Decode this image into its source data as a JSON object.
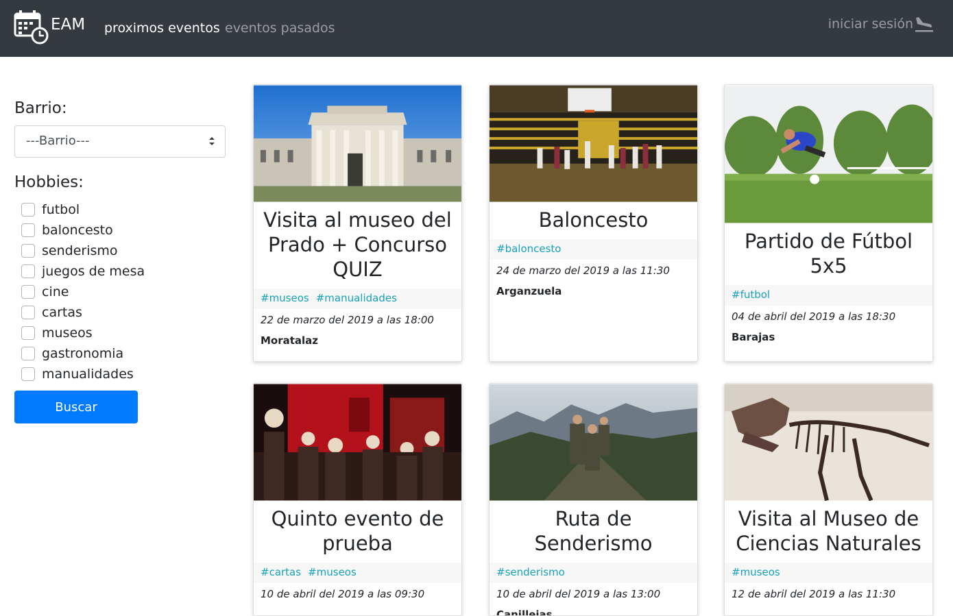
{
  "nav": {
    "brand": "EAM",
    "links": [
      "proximos eventos",
      "eventos pasados"
    ],
    "login": "iniciar sesión"
  },
  "sidebar": {
    "barrio_label": "Barrio:",
    "barrio_select": "---Barrio---",
    "hobbies_label": "Hobbies:",
    "hobbies": [
      "futbol",
      "baloncesto",
      "senderismo",
      "juegos de mesa",
      "cine",
      "cartas",
      "museos",
      "gastronomia",
      "manualidades"
    ],
    "search_button": "Buscar"
  },
  "events": [
    {
      "title": "Visita al museo del Prado + Concurso QUIZ",
      "tags": [
        "#museos",
        "#manualidades"
      ],
      "date": "22 de marzo del 2019 a las 18:00",
      "place": "Moratalaz"
    },
    {
      "title": "Baloncesto",
      "tags": [
        "#baloncesto"
      ],
      "date": "24 de marzo del 2019 a las 11:30",
      "place": "Arganzuela"
    },
    {
      "title": "Partido de Fútbol 5x5",
      "tags": [
        "#futbol"
      ],
      "date": "04 de abril del 2019 a las 18:30",
      "place": "Barajas"
    },
    {
      "title": "Quinto evento de prueba",
      "tags": [
        "#cartas",
        "#museos"
      ],
      "date": "10 de abril del 2019 a las 09:30",
      "place": ""
    },
    {
      "title": "Ruta de Senderismo",
      "tags": [
        "#senderismo"
      ],
      "date": "10 de abril del 2019 a las 13:00",
      "place": "Canillejas"
    },
    {
      "title": "Visita al Museo de Ciencias Naturales",
      "tags": [
        "#museos"
      ],
      "date": "12 de abril del 2019 a las 11:30",
      "place": ""
    }
  ],
  "colors": {
    "navbar": "#343a40",
    "primary": "#007bff",
    "tag": "#17a2b8"
  }
}
